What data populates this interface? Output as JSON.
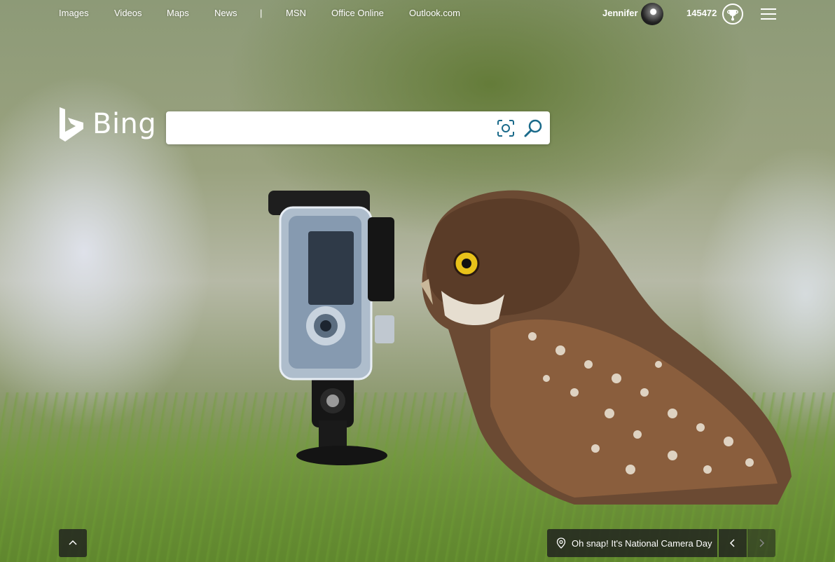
{
  "nav": {
    "links": [
      "Images",
      "Videos",
      "Maps",
      "News",
      "MSN",
      "Office Online",
      "Outlook.com"
    ],
    "separator": "|"
  },
  "account": {
    "name": "Jennifer",
    "rewards_points": "145472"
  },
  "logo": {
    "text": "Bing"
  },
  "search": {
    "value": "",
    "placeholder": ""
  },
  "caption": {
    "text": "Oh snap! It's National Camera Day"
  },
  "colors": {
    "search_icon": "#1a6a8a",
    "bottom_bar": "#1e1e1e"
  },
  "icons": {
    "visual_search": "camera-scan-icon",
    "search": "magnifier-icon",
    "location": "map-pin-icon",
    "menu": "hamburger-icon",
    "rewards": "trophy-icon"
  }
}
